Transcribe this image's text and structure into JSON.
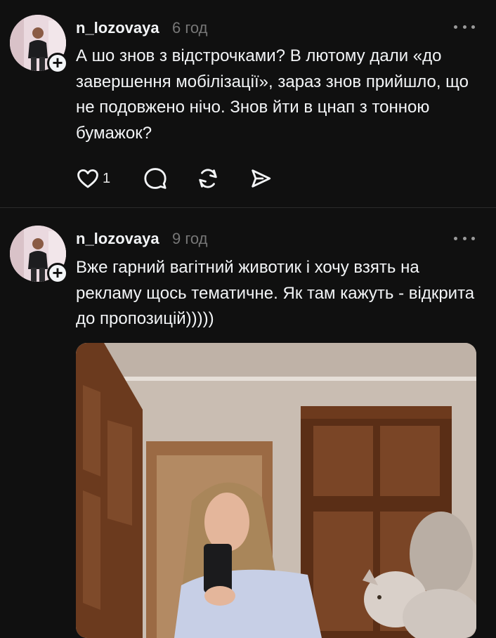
{
  "posts": [
    {
      "username": "n_lozovaya",
      "time": "6 год",
      "text": "А шо знов з відстрочками? В лютому дали «до завершення мобілізації», зараз знов прийшло, що не подовжено нічо. Знов йти в цнап з тонною бумажок?",
      "likes": "1"
    },
    {
      "username": "n_lozovaya",
      "time": "9 год",
      "text": "Вже гарний вагітний животик і хочу взять на рекламу щось тематичне. Як там кажуть - відкрита до пропозицій)))))"
    }
  ],
  "icons": {
    "like": "heart-icon",
    "comment": "comment-icon",
    "repost": "repost-icon",
    "share": "send-icon",
    "more": "more-icon",
    "follow": "plus-icon"
  },
  "colors": {
    "background": "#101010",
    "text": "#f3f5f7",
    "secondary": "#777777",
    "divider": "#2b2b2b"
  }
}
